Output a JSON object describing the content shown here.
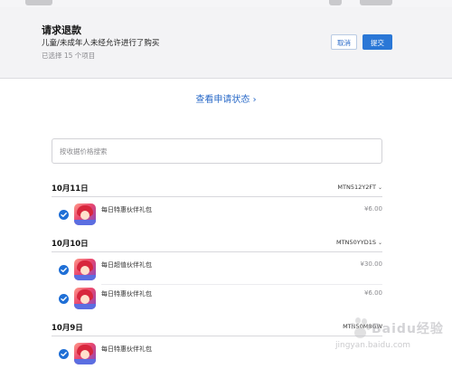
{
  "refund": {
    "title": "请求退款",
    "description": "儿童/未成年人未经允许进行了购买",
    "selected_text": "已选择 15 个项目",
    "cancel_label": "取消",
    "submit_label": "提交"
  },
  "status_link": "查看申请状态 ›",
  "search": {
    "placeholder": "按收据价格搜索"
  },
  "groups": [
    {
      "date": "10月11日",
      "order_id": "MTN512Y2FT",
      "items": [
        {
          "name": "每日特惠伙伴礼包",
          "price": "¥6.00",
          "checked": true
        }
      ]
    },
    {
      "date": "10月10日",
      "order_id": "MTN50YYD1S",
      "items": [
        {
          "name": "每日超值伙伴礼包",
          "price": "¥30.00",
          "checked": true
        },
        {
          "name": "每日特惠伙伴礼包",
          "price": "¥6.00",
          "checked": true
        }
      ]
    },
    {
      "date": "10月9日",
      "order_id": "MTN50M8GW",
      "items": [
        {
          "name": "每日特惠伙伴礼包",
          "price": "",
          "checked": true
        }
      ]
    }
  ],
  "watermark": {
    "brand": "Baidu经验",
    "url": "jingyan.baidu.com"
  },
  "colors": {
    "accent": "#2a77d6",
    "link": "#2a6ac8",
    "panel_bg": "#f3f3f5"
  },
  "icons": {
    "check": "check-circle-icon",
    "app": "game-app-icon",
    "chevron": "chevron-down-icon"
  }
}
